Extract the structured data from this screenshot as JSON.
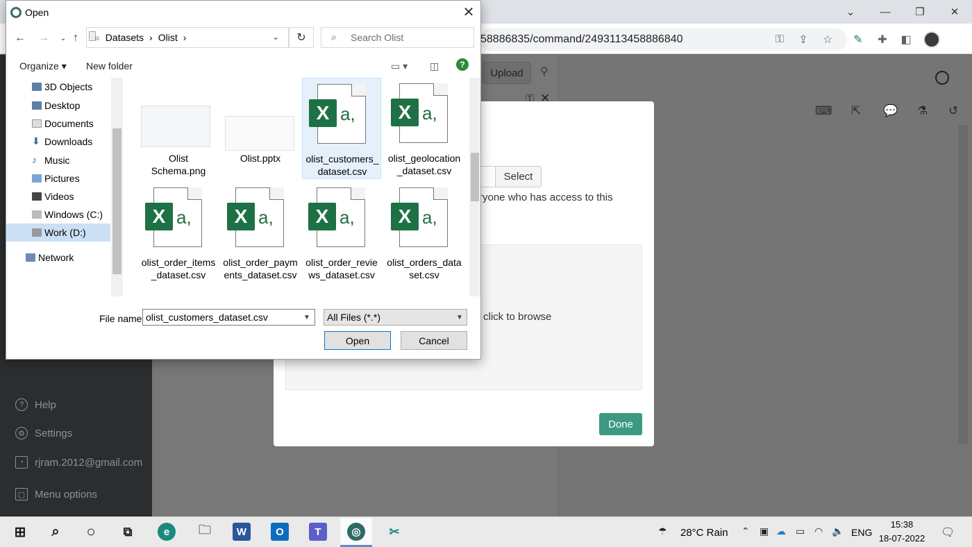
{
  "browser": {
    "address": "58886835/command/2493113458886840",
    "icons": [
      "key-icon",
      "share-icon",
      "star-icon",
      "pen-icon",
      "extensions-icon",
      "sidebar-icon",
      "profile-avatar"
    ]
  },
  "app": {
    "upload_label": "Upload",
    "sidebar": {
      "help": "Help",
      "settings": "Settings",
      "account": "rjram.2012@gmail.com",
      "menu_options": "Menu options"
    }
  },
  "modal": {
    "select_label": "Select",
    "access_text": "ryone who has access to this",
    "dropzone_text": "click to browse",
    "done_label": "Done"
  },
  "dialog": {
    "title": "Open",
    "path": [
      "«",
      "Datasets",
      "›",
      "Olist",
      "›"
    ],
    "search_placeholder": "Search Olist",
    "organize": "Organize ▾",
    "new_folder": "New folder",
    "nav": [
      {
        "label": "3D Objects"
      },
      {
        "label": "Desktop"
      },
      {
        "label": "Documents"
      },
      {
        "label": "Downloads"
      },
      {
        "label": "Music"
      },
      {
        "label": "Pictures"
      },
      {
        "label": "Videos"
      },
      {
        "label": "Windows (C:)"
      },
      {
        "label": "Work (D:)"
      },
      {
        "label": "Network"
      }
    ],
    "files": [
      {
        "name": "Olist\nSchema.png"
      },
      {
        "name": "Olist.pptx"
      },
      {
        "name": "olist_customers_\ndataset.csv"
      },
      {
        "name": "olist_geolocation\n_dataset.csv"
      },
      {
        "name": "olist_order_items\n_dataset.csv"
      },
      {
        "name": "olist_order_paym\nents_dataset.csv"
      },
      {
        "name": "olist_order_revie\nws_dataset.csv"
      },
      {
        "name": "olist_orders_data\nset.csv"
      }
    ],
    "file_name_label": "File name:",
    "file_name_value": "olist_customers_dataset.csv",
    "filter_value": "All Files (*.*)",
    "open_label": "Open",
    "cancel_label": "Cancel"
  },
  "taskbar": {
    "weather": "28°C  Rain",
    "lang": "ENG",
    "time": "15:38",
    "date": "18-07-2022"
  }
}
